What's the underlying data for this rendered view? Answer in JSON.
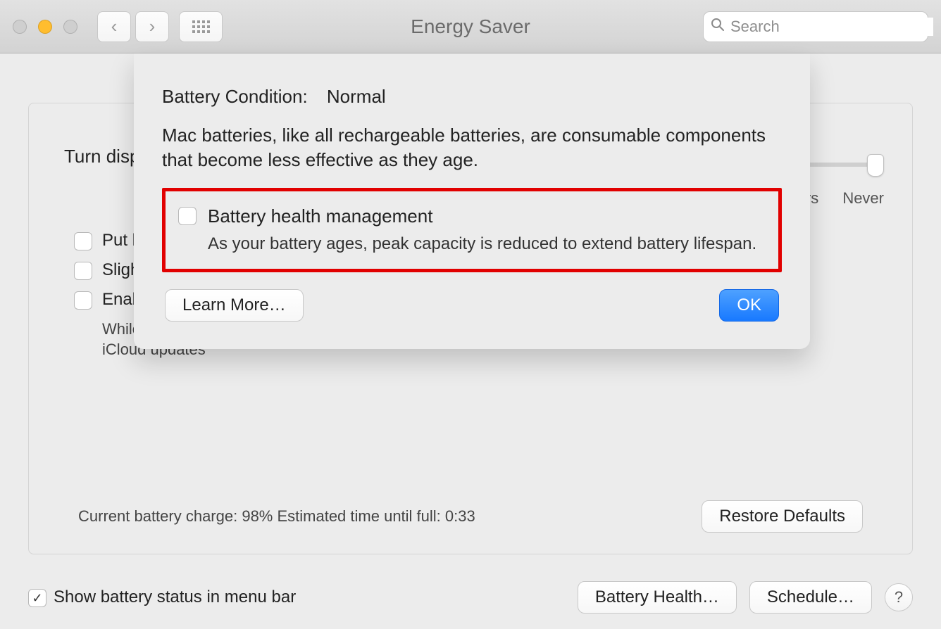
{
  "toolbar": {
    "window_title": "Energy Saver",
    "search_placeholder": "Search"
  },
  "panel": {
    "turn_display_label": "Turn displ",
    "slider_tick_hrs": "hrs",
    "slider_tick_never": "Never",
    "checks": {
      "put_hd": "Put h",
      "slight": "Sligh",
      "enable": "Enab",
      "enable_desc_line1": "While",
      "enable_desc_line2": "iCloud updates"
    },
    "status_text": "Current battery charge: 98% Estimated time until full: 0:33",
    "restore_defaults": "Restore Defaults"
  },
  "bottom": {
    "show_menu_bar": "Show battery status in menu bar",
    "battery_health_btn": "Battery Health…",
    "schedule_btn": "Schedule…"
  },
  "sheet": {
    "cond_key": "Battery Condition:",
    "cond_val": "Normal",
    "explain": "Mac batteries, like all rechargeable batteries, are consumable components that become less effective as they age.",
    "bh_label": "Battery health management",
    "bh_desc": "As your battery ages, peak capacity is reduced to extend battery lifespan.",
    "learn_more": "Learn More…",
    "ok": "OK"
  }
}
